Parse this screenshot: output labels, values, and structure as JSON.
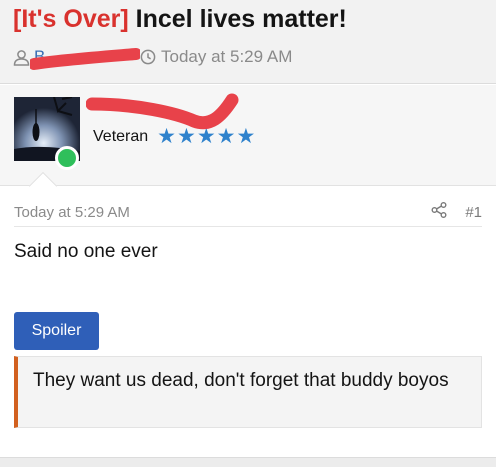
{
  "thread": {
    "prefix": "[It's Over]",
    "title": "Incel lives matter!",
    "author": "B",
    "timestamp": "Today at 5:29 AM"
  },
  "user": {
    "username": "",
    "title": "Veteran",
    "star_count": 5,
    "online": true
  },
  "post": {
    "timestamp": "Today at 5:29 AM",
    "number": "#1",
    "body": "Said no one ever",
    "spoiler_label": "Spoiler",
    "quote": "They want us dead, don't forget that buddy boyos"
  },
  "colors": {
    "prefix": "#d9322e",
    "link": "#2d62b0",
    "star": "#2f82cc",
    "online": "#2fbf5b",
    "spoiler_button": "#2f5fb8",
    "quote_border": "#d2601f",
    "redaction": "#e8424a"
  },
  "icons": {
    "author": "user-icon",
    "time": "clock-icon",
    "share": "share-icon"
  }
}
